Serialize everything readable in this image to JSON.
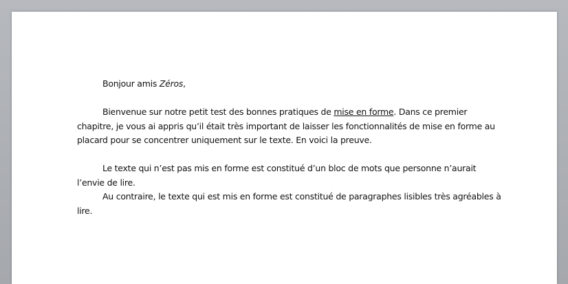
{
  "document": {
    "greeting": {
      "prefix": "Bonjour amis ",
      "name": "Zéros",
      "suffix": ","
    },
    "paragraph1": {
      "before": "Bienvenue sur notre petit test des bonnes pratiques de ",
      "link": "mise en forme",
      "after": ". Dans ce premier chapitre, je vous ai appris qu’il était très important de laisser les fonctionnalités de mise en forme au placard pour se concentrer uniquement sur le texte. En voici la preuve."
    },
    "paragraph2": "Le texte qui n’est pas mis  en forme est constitué d’un bloc de mots que personne n’aurait l’envie de lire.",
    "paragraph3": "Au contraire, le texte qui est mis  en forme est constitué de paragraphes lisibles très agréables à lire."
  }
}
